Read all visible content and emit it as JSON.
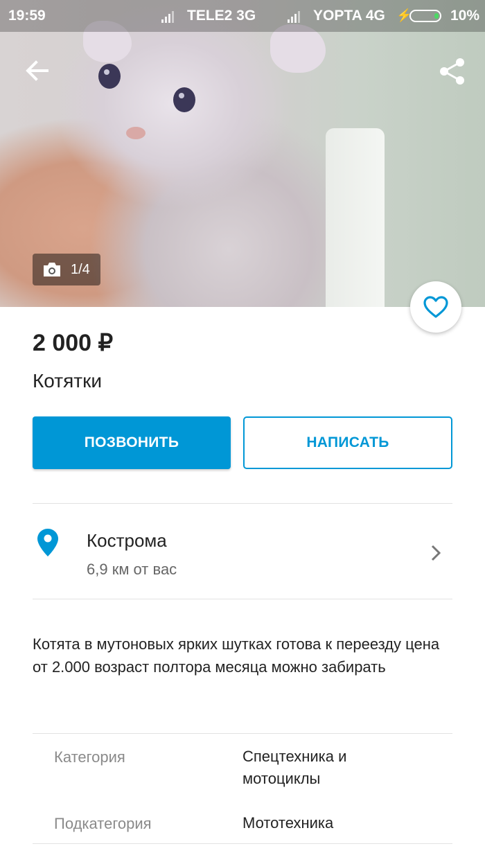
{
  "status_bar": {
    "time": "19:59",
    "carrier1": "TELE2 3G",
    "carrier2": "YOPTA 4G",
    "battery": "10%"
  },
  "gallery": {
    "counter": "1/4"
  },
  "listing": {
    "price": "2 000 ₽",
    "title": "Котятки"
  },
  "actions": {
    "call_label": "ПОЗВОНИТЬ",
    "write_label": "НАПИСАТЬ",
    "accent_color": "#0097d6"
  },
  "location": {
    "city": "Кострома",
    "distance": "6,9 км от вас"
  },
  "description": "Котята в мутоновых ярких шутках готова к переезду цена от 2.000 возраст полтора месяца можно забирать",
  "params": [
    {
      "label": "Категория",
      "value": "Спецтехника и мотоциклы"
    },
    {
      "label": "Подкатегория",
      "value": "Мототехника"
    }
  ],
  "icons": {
    "back": "arrow-left-icon",
    "share": "share-icon",
    "camera": "camera-icon",
    "favorite": "heart-icon",
    "location": "map-pin-icon",
    "chevron": "chevron-right-icon"
  }
}
